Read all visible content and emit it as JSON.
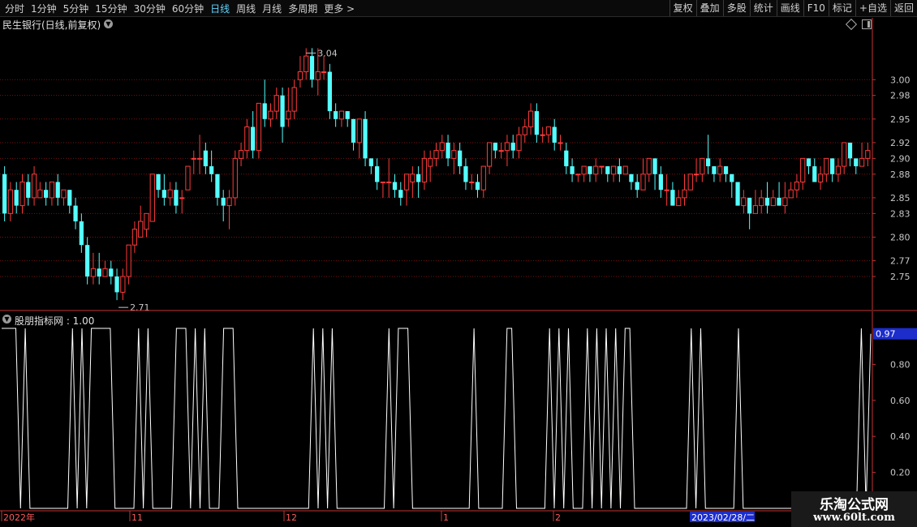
{
  "toolbar": {
    "left": [
      "分时",
      "1分钟",
      "5分钟",
      "15分钟",
      "30分钟",
      "60分钟",
      "日线",
      "周线",
      "月线",
      "多周期",
      "更多 >"
    ],
    "active": "日线",
    "right": [
      "复权",
      "叠加",
      "多股",
      "统计",
      "画线",
      "F10",
      "标记",
      "+自选",
      "返回"
    ]
  },
  "main_title": "民生银行(日线,前复权)",
  "indicator_title": "股朋指标网 : 1.00",
  "date_bar": {
    "labels": [
      "2022年",
      "11",
      "12",
      "1",
      "2"
    ],
    "cursor_date": "2023/02/28/二"
  },
  "watermark": {
    "name": "乐淘公式网",
    "url": "www.60lt.com"
  },
  "colors": {
    "up": "#ff3b3b",
    "down": "#54ffff",
    "grid": "#7a1010",
    "axis": "#c43434",
    "line": "#ffffff",
    "label_box": "#1c2dcc"
  },
  "chart_data": [
    {
      "type": "candlestick",
      "title": "民生银行(日线,前复权)",
      "ylim": [
        2.715,
        3.06
      ],
      "y_ticks": [
        "3.00",
        "2.98",
        "2.95",
        "2.92",
        "2.90",
        "2.88",
        "2.85",
        "2.83",
        "2.80",
        "2.77",
        "2.75"
      ],
      "max_label": "3.04",
      "min_label": "2.71",
      "candles": [
        [
          2.88,
          2.83,
          2.89,
          2.82
        ],
        [
          2.83,
          2.86,
          2.87,
          2.82
        ],
        [
          2.86,
          2.84,
          2.87,
          2.83
        ],
        [
          2.84,
          2.87,
          2.88,
          2.83
        ],
        [
          2.87,
          2.85,
          2.88,
          2.84
        ],
        [
          2.85,
          2.88,
          2.89,
          2.84
        ],
        [
          2.85,
          2.86,
          2.87,
          2.85
        ],
        [
          2.86,
          2.85,
          2.87,
          2.84
        ],
        [
          2.85,
          2.87,
          2.87,
          2.84
        ],
        [
          2.87,
          2.85,
          2.88,
          2.84
        ],
        [
          2.85,
          2.86,
          2.86,
          2.84
        ],
        [
          2.86,
          2.84,
          2.86,
          2.83
        ],
        [
          2.84,
          2.82,
          2.85,
          2.81
        ],
        [
          2.82,
          2.79,
          2.83,
          2.78
        ],
        [
          2.79,
          2.75,
          2.8,
          2.74
        ],
        [
          2.75,
          2.76,
          2.78,
          2.74
        ],
        [
          2.76,
          2.75,
          2.78,
          2.74
        ],
        [
          2.75,
          2.76,
          2.77,
          2.75
        ],
        [
          2.76,
          2.75,
          2.77,
          2.74
        ],
        [
          2.75,
          2.73,
          2.76,
          2.72
        ],
        [
          2.73,
          2.75,
          2.76,
          2.72
        ],
        [
          2.75,
          2.79,
          2.79,
          2.74
        ],
        [
          2.79,
          2.81,
          2.82,
          2.78
        ],
        [
          2.8,
          2.82,
          2.84,
          2.8
        ],
        [
          2.81,
          2.83,
          2.83,
          2.8
        ],
        [
          2.82,
          2.88,
          2.88,
          2.82
        ],
        [
          2.88,
          2.86,
          2.88,
          2.85
        ],
        [
          2.86,
          2.85,
          2.88,
          2.84
        ],
        [
          2.85,
          2.86,
          2.87,
          2.84
        ],
        [
          2.86,
          2.84,
          2.87,
          2.83
        ],
        [
          2.85,
          2.85,
          2.86,
          2.83
        ],
        [
          2.86,
          2.89,
          2.89,
          2.86
        ],
        [
          2.9,
          2.9,
          2.91,
          2.88
        ],
        [
          2.9,
          2.9,
          2.93,
          2.88
        ],
        [
          2.91,
          2.89,
          2.92,
          2.88
        ],
        [
          2.89,
          2.88,
          2.91,
          2.87
        ],
        [
          2.88,
          2.85,
          2.88,
          2.84
        ],
        [
          2.85,
          2.84,
          2.86,
          2.82
        ],
        [
          2.84,
          2.85,
          2.86,
          2.81
        ],
        [
          2.85,
          2.9,
          2.91,
          2.84
        ],
        [
          2.9,
          2.91,
          2.92,
          2.89
        ],
        [
          2.91,
          2.94,
          2.95,
          2.9
        ],
        [
          2.94,
          2.91,
          2.96,
          2.9
        ],
        [
          2.91,
          2.97,
          2.97,
          2.9
        ],
        [
          2.97,
          2.95,
          3.0,
          2.94
        ],
        [
          2.95,
          2.96,
          2.97,
          2.94
        ],
        [
          2.96,
          2.98,
          2.99,
          2.95
        ],
        [
          2.98,
          2.94,
          2.99,
          2.92
        ],
        [
          2.95,
          2.96,
          2.99,
          2.94
        ],
        [
          2.96,
          2.99,
          3.0,
          2.95
        ],
        [
          3.0,
          3.01,
          3.03,
          2.99
        ],
        [
          3.01,
          3.03,
          3.04,
          3.0
        ],
        [
          3.03,
          3.0,
          3.04,
          2.99
        ],
        [
          3.0,
          3.01,
          3.04,
          2.98
        ],
        [
          3.01,
          3.01,
          3.03,
          3.0
        ],
        [
          3.01,
          2.96,
          3.02,
          2.95
        ],
        [
          2.96,
          2.95,
          2.97,
          2.94
        ],
        [
          2.95,
          2.96,
          2.96,
          2.94
        ],
        [
          2.96,
          2.95,
          2.96,
          2.94
        ],
        [
          2.95,
          2.92,
          2.95,
          2.91
        ],
        [
          2.92,
          2.95,
          2.95,
          2.9
        ],
        [
          2.95,
          2.9,
          2.96,
          2.89
        ],
        [
          2.9,
          2.89,
          2.9,
          2.88
        ],
        [
          2.89,
          2.87,
          2.9,
          2.86
        ],
        [
          2.87,
          2.87,
          2.87,
          2.85
        ],
        [
          2.87,
          2.87,
          2.9,
          2.85
        ],
        [
          2.87,
          2.86,
          2.88,
          2.85
        ],
        [
          2.86,
          2.85,
          2.87,
          2.84
        ],
        [
          2.86,
          2.88,
          2.88,
          2.84
        ],
        [
          2.87,
          2.88,
          2.89,
          2.85
        ],
        [
          2.88,
          2.87,
          2.89,
          2.85
        ],
        [
          2.87,
          2.9,
          2.91,
          2.86
        ],
        [
          2.89,
          2.9,
          2.91,
          2.87
        ],
        [
          2.9,
          2.91,
          2.92,
          2.89
        ],
        [
          2.91,
          2.92,
          2.93,
          2.9
        ],
        [
          2.92,
          2.9,
          2.93,
          2.89
        ],
        [
          2.9,
          2.91,
          2.92,
          2.88
        ],
        [
          2.91,
          2.89,
          2.92,
          2.88
        ],
        [
          2.89,
          2.87,
          2.9,
          2.86
        ],
        [
          2.87,
          2.87,
          2.88,
          2.86
        ],
        [
          2.87,
          2.86,
          2.88,
          2.85
        ],
        [
          2.86,
          2.89,
          2.89,
          2.85
        ],
        [
          2.89,
          2.92,
          2.92,
          2.88
        ],
        [
          2.92,
          2.91,
          2.92,
          2.9
        ],
        [
          2.91,
          2.91,
          2.92,
          2.9
        ],
        [
          2.91,
          2.92,
          2.93,
          2.89
        ],
        [
          2.92,
          2.91,
          2.93,
          2.9
        ],
        [
          2.91,
          2.93,
          2.94,
          2.9
        ],
        [
          2.93,
          2.94,
          2.95,
          2.92
        ],
        [
          2.94,
          2.96,
          2.97,
          2.93
        ],
        [
          2.96,
          2.93,
          2.97,
          2.92
        ],
        [
          2.93,
          2.93,
          2.94,
          2.92
        ],
        [
          2.93,
          2.94,
          2.94,
          2.92
        ],
        [
          2.94,
          2.92,
          2.95,
          2.91
        ],
        [
          2.92,
          2.92,
          2.93,
          2.91
        ],
        [
          2.91,
          2.89,
          2.92,
          2.88
        ],
        [
          2.89,
          2.88,
          2.9,
          2.87
        ],
        [
          2.88,
          2.88,
          2.88,
          2.87
        ],
        [
          2.88,
          2.89,
          2.89,
          2.87
        ],
        [
          2.89,
          2.88,
          2.89,
          2.87
        ],
        [
          2.88,
          2.89,
          2.9,
          2.87
        ],
        [
          2.89,
          2.89,
          2.89,
          2.88
        ],
        [
          2.89,
          2.88,
          2.89,
          2.87
        ],
        [
          2.88,
          2.89,
          2.89,
          2.87
        ],
        [
          2.89,
          2.88,
          2.9,
          2.87
        ],
        [
          2.88,
          2.89,
          2.89,
          2.88
        ],
        [
          2.88,
          2.87,
          2.88,
          2.86
        ],
        [
          2.87,
          2.86,
          2.88,
          2.85
        ],
        [
          2.86,
          2.88,
          2.9,
          2.86
        ],
        [
          2.88,
          2.9,
          2.9,
          2.87
        ],
        [
          2.9,
          2.88,
          2.9,
          2.86
        ],
        [
          2.88,
          2.86,
          2.89,
          2.85
        ],
        [
          2.86,
          2.86,
          2.88,
          2.84
        ],
        [
          2.86,
          2.84,
          2.87,
          2.84
        ],
        [
          2.84,
          2.85,
          2.86,
          2.84
        ],
        [
          2.85,
          2.86,
          2.88,
          2.84
        ],
        [
          2.86,
          2.88,
          2.88,
          2.86
        ],
        [
          2.88,
          2.88,
          2.9,
          2.87
        ],
        [
          2.88,
          2.9,
          2.9,
          2.87
        ],
        [
          2.9,
          2.89,
          2.93,
          2.88
        ],
        [
          2.89,
          2.88,
          2.89,
          2.87
        ],
        [
          2.88,
          2.89,
          2.9,
          2.87
        ],
        [
          2.89,
          2.88,
          2.89,
          2.87
        ],
        [
          2.88,
          2.87,
          2.88,
          2.85
        ],
        [
          2.87,
          2.84,
          2.87,
          2.84
        ],
        [
          2.84,
          2.85,
          2.86,
          2.83
        ],
        [
          2.85,
          2.83,
          2.85,
          2.81
        ],
        [
          2.83,
          2.84,
          2.86,
          2.83
        ],
        [
          2.84,
          2.85,
          2.86,
          2.83
        ],
        [
          2.85,
          2.84,
          2.87,
          2.83
        ],
        [
          2.84,
          2.85,
          2.86,
          2.84
        ],
        [
          2.85,
          2.84,
          2.87,
          2.84
        ],
        [
          2.84,
          2.85,
          2.87,
          2.83
        ],
        [
          2.85,
          2.86,
          2.87,
          2.85
        ],
        [
          2.86,
          2.87,
          2.88,
          2.85
        ],
        [
          2.87,
          2.9,
          2.9,
          2.86
        ],
        [
          2.9,
          2.89,
          2.9,
          2.88
        ],
        [
          2.89,
          2.87,
          2.9,
          2.87
        ],
        [
          2.87,
          2.88,
          2.89,
          2.86
        ],
        [
          2.88,
          2.9,
          2.9,
          2.87
        ],
        [
          2.9,
          2.88,
          2.9,
          2.87
        ],
        [
          2.88,
          2.89,
          2.9,
          2.87
        ],
        [
          2.89,
          2.92,
          2.92,
          2.88
        ],
        [
          2.92,
          2.9,
          2.92,
          2.89
        ],
        [
          2.9,
          2.89,
          2.9,
          2.88
        ],
        [
          2.89,
          2.9,
          2.92,
          2.89
        ],
        [
          2.9,
          2.91,
          2.92,
          2.89
        ]
      ]
    },
    {
      "type": "line",
      "title": "股朋指标网",
      "ylim": [
        0,
        1.0
      ],
      "y_ticks": [
        "0.80",
        "0.60",
        "0.40",
        "0.20"
      ],
      "last_value_label": "0.97",
      "series": [
        {
          "values": [
            1,
            1,
            1,
            1,
            0,
            1,
            0,
            0,
            0,
            0,
            0,
            0,
            0,
            0,
            0,
            1,
            0,
            1,
            0,
            1,
            1,
            1,
            1,
            1,
            0,
            0,
            0,
            0,
            0,
            1,
            0,
            1,
            0,
            0,
            0,
            0,
            0,
            1,
            1,
            1,
            0,
            1,
            0,
            1,
            0,
            0,
            0,
            1,
            1,
            1,
            0,
            0,
            0,
            0,
            0,
            0,
            0,
            0,
            0,
            0,
            0,
            0,
            0,
            0,
            0,
            0,
            1,
            0,
            1,
            0,
            1,
            0,
            0,
            0,
            0,
            0,
            0,
            0,
            0,
            0,
            0,
            0,
            1,
            0,
            1,
            1,
            1,
            0,
            0,
            0,
            0,
            0,
            0,
            0,
            0,
            0,
            0,
            0,
            0,
            0,
            1,
            0,
            0,
            0,
            0,
            0,
            0,
            1,
            1,
            0,
            0,
            0,
            0,
            0,
            0,
            0,
            1,
            0,
            1,
            0,
            1,
            0,
            0,
            0,
            1,
            0,
            1,
            0,
            1,
            0,
            1,
            0,
            1,
            1,
            0,
            0,
            0,
            0,
            0,
            0,
            0,
            0,
            0,
            0,
            0,
            0,
            1,
            0,
            1,
            0,
            0,
            0,
            0,
            0,
            0,
            0,
            1,
            0,
            0,
            0,
            0,
            0,
            0,
            0,
            0,
            0,
            0,
            0,
            0,
            0,
            0,
            0,
            0,
            0,
            0,
            0,
            0,
            0,
            0,
            0,
            0,
            0,
            1,
            0,
            0.97
          ]
        }
      ]
    }
  ]
}
